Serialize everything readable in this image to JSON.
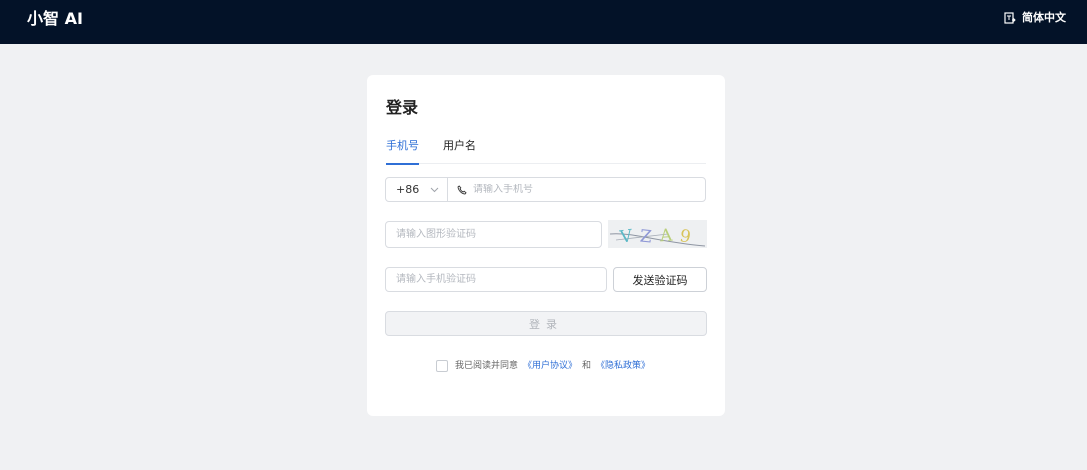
{
  "header": {
    "brand": "小智 AI",
    "language": "简体中文",
    "language_icon": "language-switch-icon"
  },
  "login": {
    "title": "登录",
    "tabs": [
      {
        "label": "手机号",
        "active": true
      },
      {
        "label": "用户名",
        "active": false
      }
    ],
    "country_code": "+86",
    "phone_placeholder": "请输入手机号",
    "captcha_placeholder": "请输入图形验证码",
    "captcha_text": "VZA9",
    "sms_placeholder": "请输入手机验证码",
    "send_code_label": "发送验证码",
    "submit_label": "登录",
    "agreement": {
      "prefix": "我已阅读并同意",
      "user_agreement": "《用户协议》",
      "and": "和",
      "privacy_policy": "《隐私政策》",
      "checked": false
    }
  },
  "colors": {
    "header_bg": "#031228",
    "accent": "#2f6fd6",
    "page_bg": "#f0f1f3"
  }
}
